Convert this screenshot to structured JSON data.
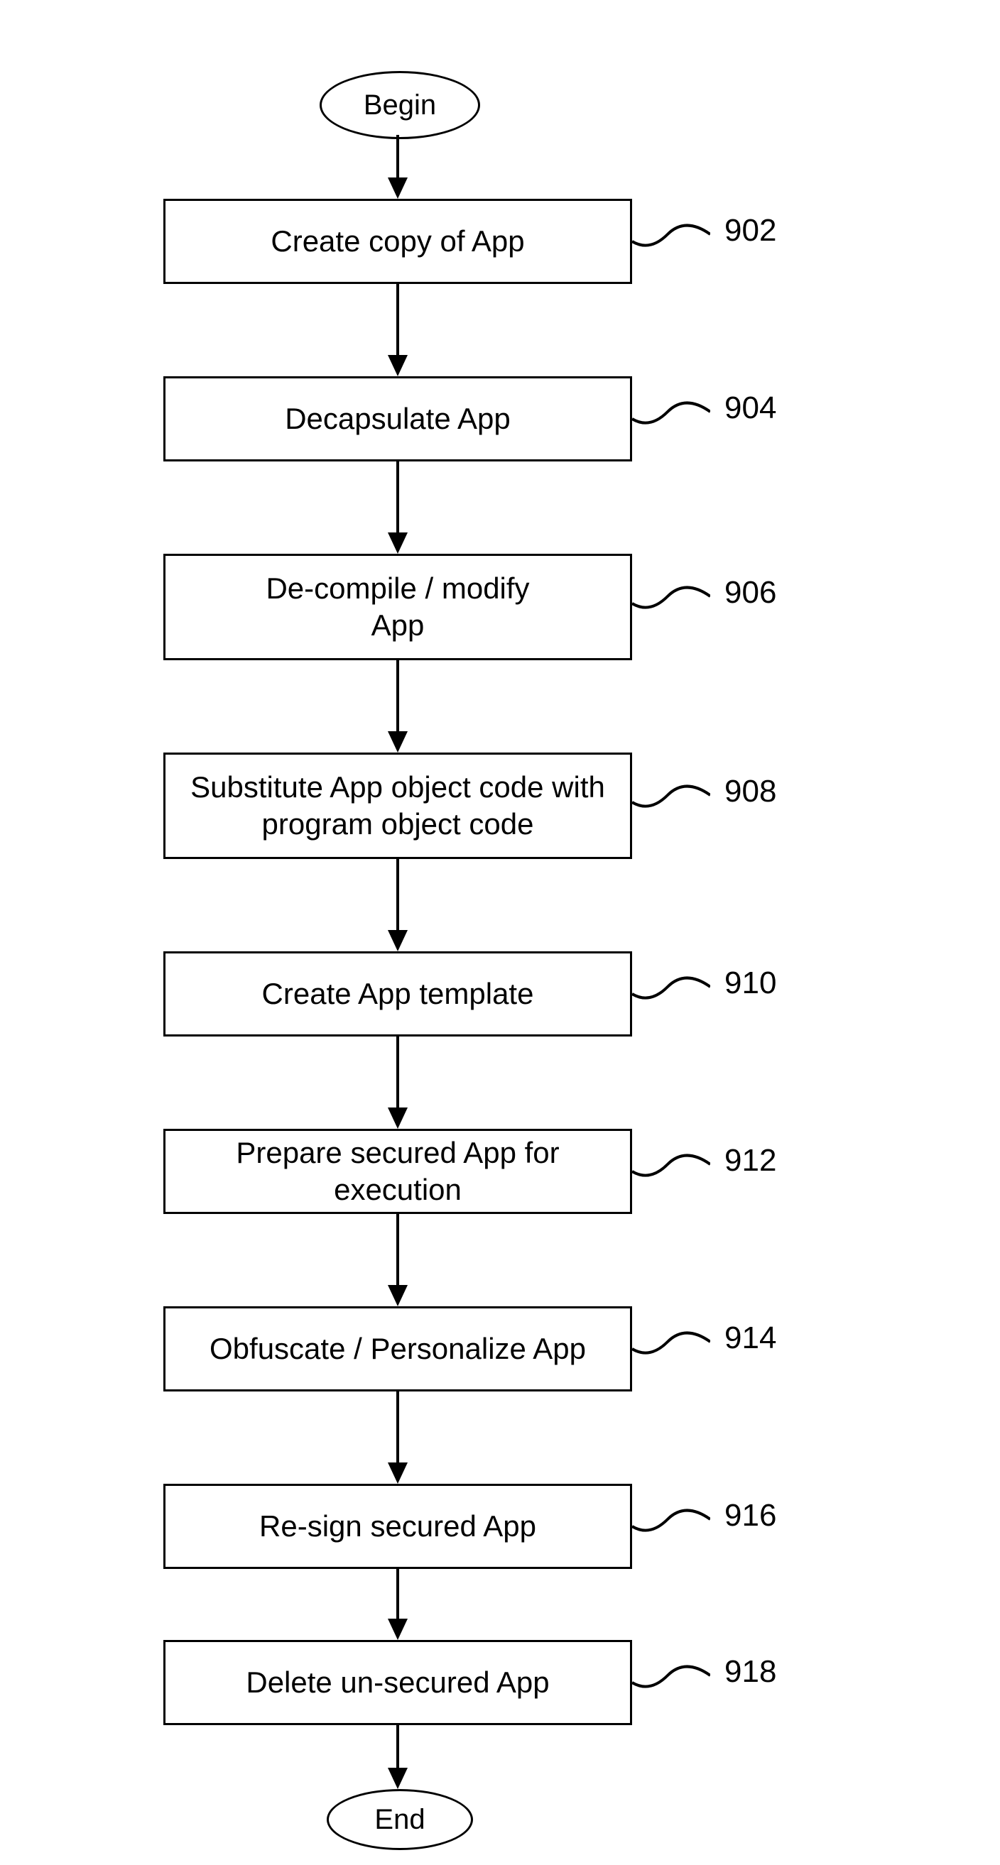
{
  "terminators": {
    "begin": "Begin",
    "end": "End"
  },
  "steps": [
    {
      "label": "Create copy of App",
      "ref": "902"
    },
    {
      "label": "Decapsulate App",
      "ref": "904"
    },
    {
      "label": "De-compile / modify\nApp",
      "ref": "906"
    },
    {
      "label": "Substitute App object code with\nprogram object code",
      "ref": "908"
    },
    {
      "label": "Create App template",
      "ref": "910"
    },
    {
      "label": "Prepare secured App for execution",
      "ref": "912"
    },
    {
      "label": "Obfuscate / Personalize App",
      "ref": "914"
    },
    {
      "label": "Re-sign secured App",
      "ref": "916"
    },
    {
      "label": "Delete un-secured App",
      "ref": "918"
    }
  ]
}
